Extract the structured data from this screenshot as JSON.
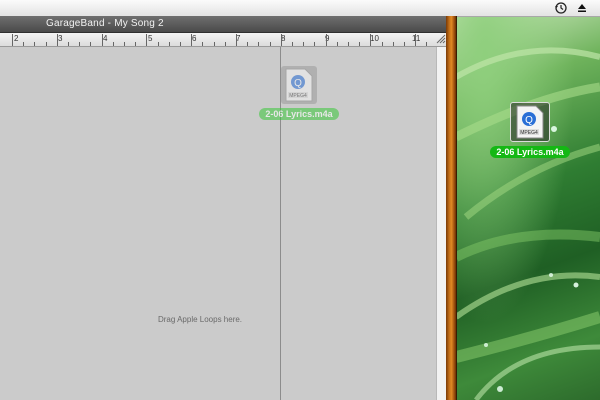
{
  "window": {
    "title": "GarageBand - My Song 2",
    "drop_hint": "Drag Apple Loops here."
  },
  "ruler": {
    "labels": [
      "2",
      "3",
      "4",
      "5",
      "6",
      "7",
      "8",
      "9",
      "10",
      "11"
    ]
  },
  "menubar": {
    "icons": [
      "time-machine-icon",
      "eject-icon"
    ]
  },
  "dragged_file": {
    "name": "2-06 Lyrics.m4a",
    "icon_text": "MPEG4"
  },
  "desktop_file": {
    "name": "2-06 Lyrics.m4a",
    "icon_text": "MPEG4"
  },
  "colors": {
    "selection_green": "#14b814",
    "wood": "#c8731a",
    "titlebar": "#555555"
  }
}
